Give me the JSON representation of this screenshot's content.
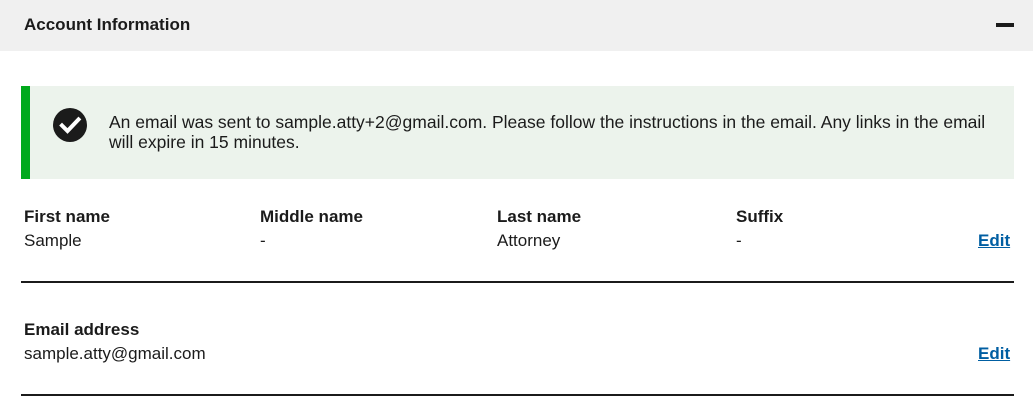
{
  "section": {
    "title": "Account Information",
    "toggle_icon": "minus-icon"
  },
  "alert": {
    "status": "success",
    "icon": "check-circle-icon",
    "message": "An email was sent to sample.atty+2@gmail.com. Please follow the instructions in the email. Any links in the email will expire in 15 minutes.",
    "accent_color": "#00a91c",
    "background_color": "#ecf3ec"
  },
  "name": {
    "first_label": "First name",
    "first_value": "Sample",
    "middle_label": "Middle name",
    "middle_value": "-",
    "last_label": "Last name",
    "last_value": "Attorney",
    "suffix_label": "Suffix",
    "suffix_value": "-",
    "edit_label": "Edit"
  },
  "email": {
    "label": "Email address",
    "value": "sample.atty@gmail.com",
    "edit_label": "Edit"
  },
  "colors": {
    "link": "#005ea2",
    "header_bg": "#f0f0f0"
  }
}
